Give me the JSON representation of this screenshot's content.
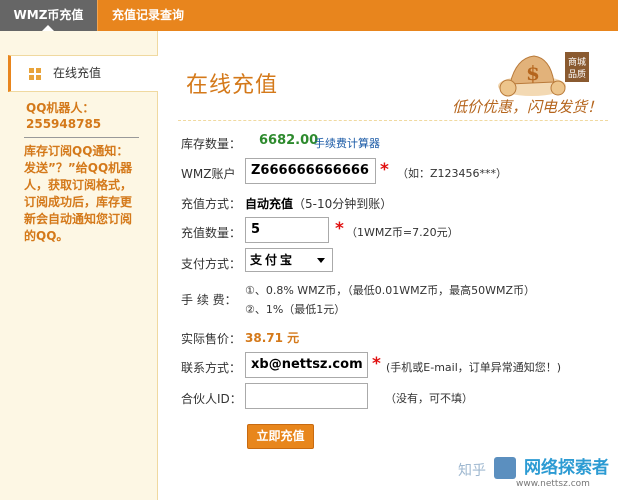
{
  "tabs": [
    {
      "label": "WMZ币充值",
      "active": true
    },
    {
      "label": "充值记录查询",
      "active": false
    }
  ],
  "sidebar": {
    "item_label": "在线充值",
    "qq_title": "QQ机器人：",
    "qq_number": "255948785",
    "notice_lines": [
      "库存订阅QQ通知：",
      "发送”？”给QQ机器",
      "人，获取订阅格式，",
      "订阅成功后，库存更",
      "新会自动通知您订阅",
      "的QQ。"
    ]
  },
  "page_title": "在线充值",
  "banner": {
    "stamp_line1": "商城",
    "stamp_line2": "品质",
    "slogan": "低价优惠，闪电发货！"
  },
  "form": {
    "stock_label": "库存数量：",
    "stock_value": "6682.00",
    "calc_link": "手续费计算器",
    "wmz_label": "WMZ账户",
    "wmz_value": "Z666666666666",
    "wmz_hint": "（如：Z123456***）",
    "method_label": "充值方式：",
    "method_value": "自动充值",
    "method_note": "（5-10分钟到账）",
    "qty_label": "充值数量：",
    "qty_value": "5",
    "qty_hint": "（1WMZ币=7.20元）",
    "pay_label": "支付方式：",
    "pay_value": "支付宝",
    "fee_label": "手 续 费：",
    "fee_line1": "①、0.8% WMZ币，（最低0.01WMZ币，最高50WMZ币）",
    "fee_line2": "②、1%（最低1元）",
    "price_label": "实际售价：",
    "price_value": "38.71 元",
    "contact_label": "联系方式：",
    "contact_value": "xb@nettsz.com",
    "contact_hint": "(手机或E-mail，订单异常通知您！)",
    "partner_label": "合伙人ID：",
    "partner_value": "",
    "partner_hint": "（没有，可不填）",
    "required_mark": "*",
    "submit_label": "立即充值"
  },
  "watermark": {
    "text1": "知乎",
    "text2": "网络探索者",
    "url": "www.nettsz.com"
  },
  "colors": {
    "accent": "#e8851d",
    "orange_text": "#d4791a",
    "green_value": "#2d8a2d",
    "link": "#1a5aa6",
    "required": "#e01010"
  }
}
